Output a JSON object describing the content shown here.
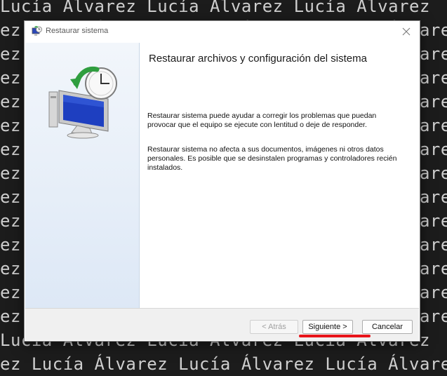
{
  "background": {
    "lines": [
      "Lucía Álvarez Lucía Álvarez Lucía Álvarez",
      "ez Lucía Álvarez Lucía Álvarez Lucía Álvarez",
      "ez Lucía Álvarez Lucía Álvarez Lucía Álvarez",
      "ez Lucía Álvarez Lucía Álvarez Lucía Álvarez",
      "ez Lucía Álvarez Lucía Álvarez Lucía Álvarez",
      "ez Lucía Álvarez Lucía Álvarez Lucía Álvarez",
      "ez Lucía Álvarez Lucía Álvarez Lucía Álvarez",
      "ez Lucía Álvarez Lucía Álvarez Lucía Álvarez",
      "ez Lucía Álvarez Lucía Álvarez Lucía Álvarez",
      "ez Lucía Álvarez Lucía Álvarez Lucía Álvarez",
      "ez Lucía Álvarez Lucía Álvarez Lucía Álvarez",
      "ez Lucía Álvarez Lucía Álvarez Lucía Álvarez",
      "ez Lucía Álvarez Lucía Álvarez Lucía Álvarez",
      "ez Lucía Álvarez Lucía Álvarez Lucía Álvarez",
      "Lucía Álvarez Lucía Álvarez Lucía Álvarez",
      "ez Lucía Álvarez Lucía Álvarez Lucía Álvarez"
    ],
    "color": "#cfcfcf"
  },
  "dialog": {
    "title": "Restaurar sistema",
    "close_icon": "close-icon",
    "heading": "Restaurar archivos y configuración del sistema",
    "paragraph1": "Restaurar sistema puede ayudar a corregir los problemas que puedan provocar que el equipo se ejecute con lentitud o deje de responder.",
    "paragraph2": "Restaurar sistema no afecta a sus documentos, imágenes ni otros datos personales. Es posible que se desinstalen programas y controladores recién instalados.",
    "buttons": {
      "back": "< Atrás",
      "next": "Siguiente >",
      "cancel": "Cancelar"
    }
  },
  "colors": {
    "annotation": "#e8141a",
    "side_panel": "#dde8f6"
  }
}
